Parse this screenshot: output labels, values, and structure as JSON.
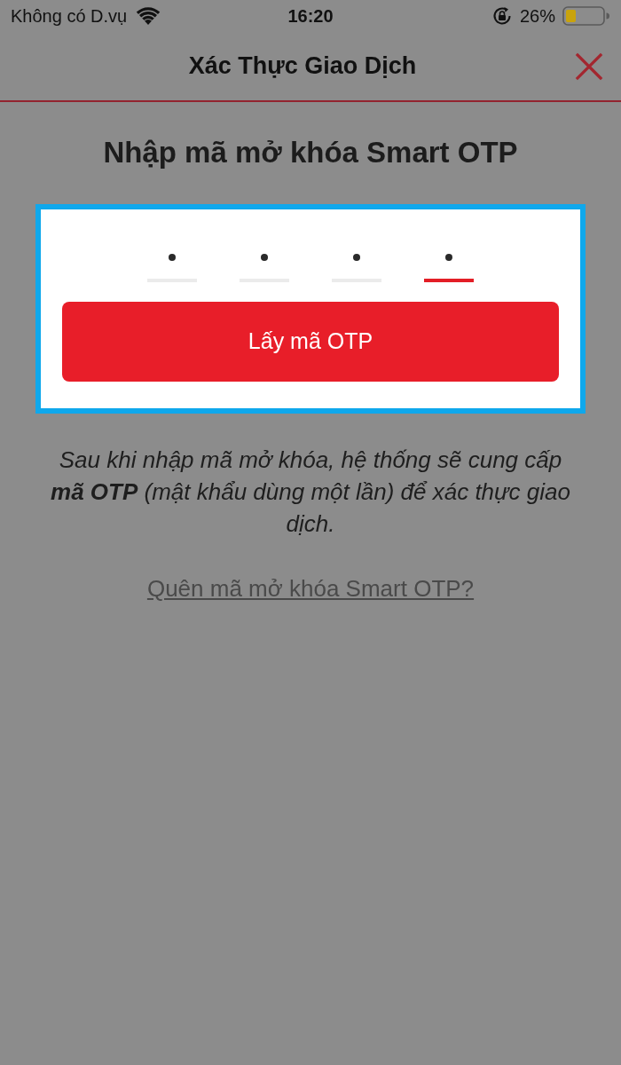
{
  "status_bar": {
    "carrier": "Không có D.vụ",
    "time": "16:20",
    "battery": "26%"
  },
  "header": {
    "title": "Xác Thực Giao Dịch"
  },
  "heading": "Nhập mã mở khóa Smart OTP",
  "otp_card": {
    "highlighted": true,
    "pin_fields": [
      {
        "filled": true,
        "selected": false
      },
      {
        "filled": true,
        "selected": false
      },
      {
        "filled": true,
        "selected": false
      },
      {
        "filled": true,
        "selected": true
      }
    ],
    "button": "Lấy mã OTP"
  },
  "description": "Sau khi nhập mã mở khóa, hệ thống sẽ cung cấp **mã OTP** (mật khẩu dùng một lần) để xác thực giao dịch.",
  "link": "Quên mã mở khóa Smart OTP?"
}
